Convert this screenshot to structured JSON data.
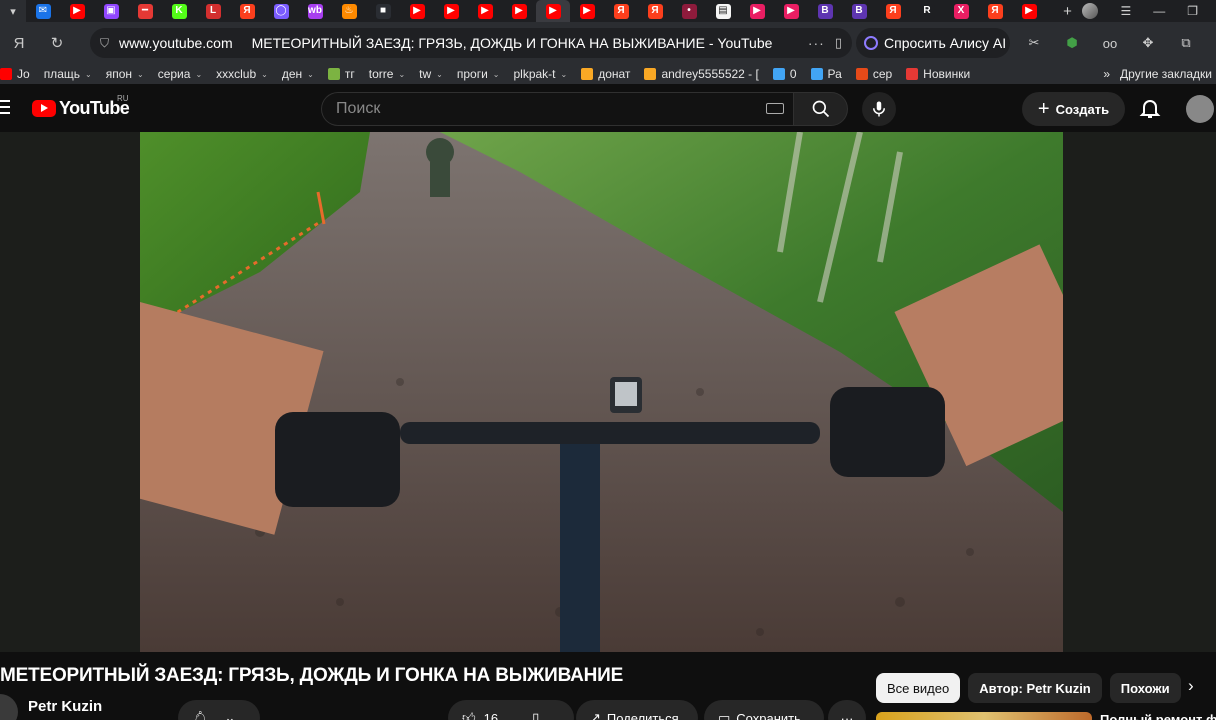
{
  "browser": {
    "tabs": [
      {
        "name": "mail",
        "color": "#1a73e8",
        "glyph": "✉"
      },
      {
        "name": "youtube",
        "color": "#ff0000",
        "glyph": "▶"
      },
      {
        "name": "twitch",
        "color": "#9146ff",
        "glyph": "▣"
      },
      {
        "name": "stream",
        "color": "#e53935",
        "glyph": "━"
      },
      {
        "name": "kick",
        "color": "#53fc18",
        "glyph": "K"
      },
      {
        "name": "live",
        "color": "#d32f2f",
        "glyph": "L"
      },
      {
        "name": "yandex",
        "color": "#fc3f1d",
        "glyph": "Я"
      },
      {
        "name": "alice",
        "color": "#7b5cff",
        "glyph": "◯"
      },
      {
        "name": "wb",
        "color": "#a83ff0",
        "glyph": "wb"
      },
      {
        "name": "fire",
        "color": "#ff8a00",
        "glyph": "♨"
      },
      {
        "name": "dark",
        "color": "#2a2d33",
        "glyph": "■"
      },
      {
        "name": "youtube",
        "color": "#ff0000",
        "glyph": "▶"
      },
      {
        "name": "youtube",
        "color": "#ff0000",
        "glyph": "▶"
      },
      {
        "name": "youtube",
        "color": "#ff0000",
        "glyph": "▶"
      },
      {
        "name": "youtube",
        "color": "#ff0000",
        "glyph": "▶"
      },
      {
        "name": "youtube-active",
        "color": "#ff0000",
        "glyph": "▶"
      },
      {
        "name": "youtube",
        "color": "#ff0000",
        "glyph": "▶"
      },
      {
        "name": "yandex",
        "color": "#fc3f1d",
        "glyph": "Я"
      },
      {
        "name": "yandex",
        "color": "#fc3f1d",
        "glyph": "Я"
      },
      {
        "name": "dots",
        "color": "#8e1b3c",
        "glyph": "•"
      },
      {
        "name": "doc",
        "color": "#f5f5f5",
        "glyph": "▤"
      },
      {
        "name": "play",
        "color": "#e91e63",
        "glyph": "▶"
      },
      {
        "name": "play",
        "color": "#e91e63",
        "glyph": "▶"
      },
      {
        "name": "b",
        "color": "#5e35b1",
        "glyph": "B"
      },
      {
        "name": "b",
        "color": "#5e35b1",
        "glyph": "B"
      },
      {
        "name": "yandex",
        "color": "#fc3f1d",
        "glyph": "Я"
      },
      {
        "name": "r",
        "color": "#1e1f22",
        "glyph": "R"
      },
      {
        "name": "x",
        "color": "#e91e63",
        "glyph": "X"
      },
      {
        "name": "yandex",
        "color": "#fc3f1d",
        "glyph": "Я"
      },
      {
        "name": "youtube",
        "color": "#ff0000",
        "glyph": "▶"
      }
    ],
    "url_domain": "www.youtube.com",
    "page_title": "МЕТЕОРИТНЫЙ ЗАЕЗД: ГРЯЗЬ, ДОЖДЬ И ГОНКА НА ВЫЖИВАНИЕ - YouTube",
    "alice_label": "Спросить Алису AI",
    "bookmarks": [
      {
        "label": "Jo",
        "color": "#ff0000",
        "menu": false
      },
      {
        "label": "плащь",
        "color": "",
        "menu": true
      },
      {
        "label": "япон",
        "color": "",
        "menu": true
      },
      {
        "label": "сериа",
        "color": "",
        "menu": true
      },
      {
        "label": "xxxclub",
        "color": "",
        "menu": true
      },
      {
        "label": "ден",
        "color": "",
        "menu": true
      },
      {
        "label": "тг",
        "color": "#7cb342",
        "menu": false
      },
      {
        "label": "torre",
        "color": "",
        "menu": true
      },
      {
        "label": "tw",
        "color": "",
        "menu": true
      },
      {
        "label": "проги",
        "color": "",
        "menu": true
      },
      {
        "label": "plkpak-t",
        "color": "",
        "menu": true
      },
      {
        "label": "донат",
        "color": "#f9a825",
        "menu": false
      },
      {
        "label": "andrey5555522 - [",
        "color": "#f9a825",
        "menu": false
      },
      {
        "label": "0",
        "color": "#42a5f5",
        "menu": false
      },
      {
        "label": "Ра",
        "color": "#42a5f5",
        "menu": false
      },
      {
        "label": "сер",
        "color": "#e64a19",
        "menu": false
      },
      {
        "label": "Новинки",
        "color": "#e53935",
        "menu": false
      }
    ],
    "bookmarks_more": "»",
    "other_bookmarks": "Другие закладки"
  },
  "youtube": {
    "logo_text": "YouTube",
    "region": "RU",
    "search_placeholder": "Поиск",
    "create_label": "Создать"
  },
  "video": {
    "title": "МЕТЕОРИТНЫЙ ЗАЕЗД: ГРЯЗЬ, ДОЖДЬ И ГОНКА НА ВЫЖИВАНИЕ",
    "channel": "Petr Kuzin",
    "likes": "16",
    "share_label": "Поделиться",
    "save_label": "Сохранить"
  },
  "related": {
    "chips": [
      "Все видео",
      "Автор: Petr Kuzin",
      "Похожи"
    ],
    "active_chip": 0,
    "next_video_title": "Полный ремонт ф"
  }
}
